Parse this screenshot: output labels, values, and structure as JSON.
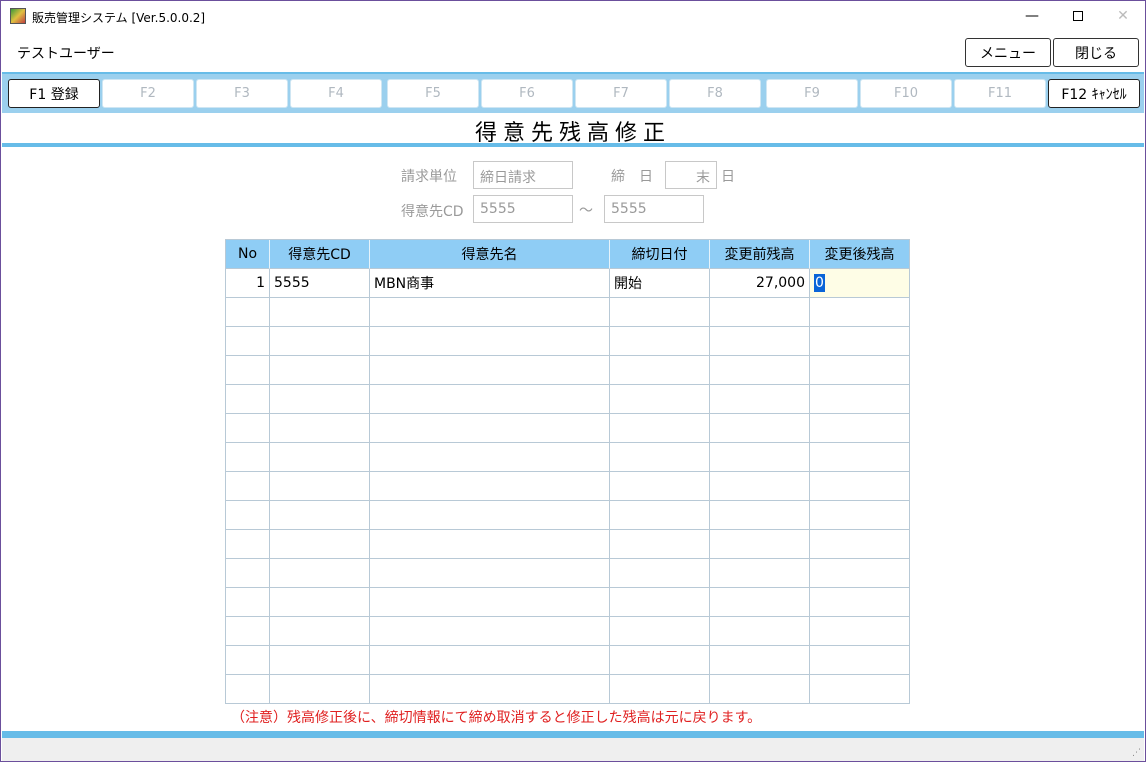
{
  "window": {
    "title": "販売管理システム [Ver.5.0.0.2]",
    "minimize_glyph": "—",
    "close_glyph": "✕"
  },
  "header": {
    "user_name": "テストユーザー",
    "menu_label": "メニュー",
    "close_label": "閉じる"
  },
  "fkeys": [
    {
      "label": "F1 登録",
      "enabled": true
    },
    {
      "label": "F2",
      "enabled": false
    },
    {
      "label": "F3",
      "enabled": false
    },
    {
      "label": "F4",
      "enabled": false
    },
    {
      "label": "F5",
      "enabled": false
    },
    {
      "label": "F6",
      "enabled": false
    },
    {
      "label": "F7",
      "enabled": false
    },
    {
      "label": "F8",
      "enabled": false
    },
    {
      "label": "F9",
      "enabled": false
    },
    {
      "label": "F10",
      "enabled": false
    },
    {
      "label": "F11",
      "enabled": false
    },
    {
      "label": "F12 ｷｬﾝｾﾙ",
      "enabled": true
    }
  ],
  "page_title": "得意先残高修正",
  "filters": {
    "billing_unit_label": "請求単位",
    "billing_unit_value": "締日請求",
    "closing_label": "締　日",
    "closing_value": "末",
    "closing_suffix": "日",
    "customer_cd_label": "得意先CD",
    "customer_cd_from": "5555",
    "range_sep": "～",
    "customer_cd_to": "5555"
  },
  "table": {
    "headers": [
      "No",
      "得意先CD",
      "得意先名",
      "締切日付",
      "変更前残高",
      "変更後残高"
    ],
    "rows": [
      {
        "no": "1",
        "cd": "5555",
        "name": "MBN商事",
        "date": "開始",
        "before": "27,000",
        "after": "0"
      }
    ],
    "empty_rows": 14
  },
  "note": "（注意）残高修正後に、締切情報にて締め取消すると修正した残高は元に戻ります。",
  "colors": {
    "accent": "#67bce8",
    "fkey_bar": "#9bd0ee",
    "table_header": "#8fcdf5",
    "warning_text": "#e02020",
    "edit_cell": "#fefde6"
  }
}
